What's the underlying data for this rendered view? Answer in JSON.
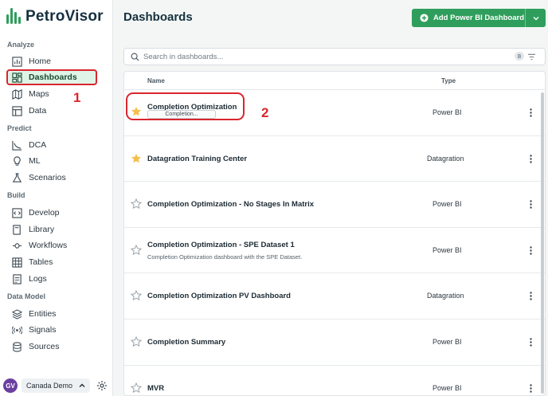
{
  "app": {
    "name": "PetroVisor",
    "brand_color": "#2f9e5c"
  },
  "sidebar": {
    "sections": [
      {
        "title": "Analyze",
        "items": [
          {
            "label": "Home",
            "icon": "chart-icon"
          },
          {
            "label": "Dashboards",
            "icon": "dashboard-icon",
            "active": true
          },
          {
            "label": "Maps",
            "icon": "map-icon"
          },
          {
            "label": "Data",
            "icon": "table-icon"
          }
        ]
      },
      {
        "title": "Predict",
        "items": [
          {
            "label": "DCA",
            "icon": "line-chart-icon"
          },
          {
            "label": "ML",
            "icon": "lightbulb-icon"
          },
          {
            "label": "Scenarios",
            "icon": "flask-icon"
          }
        ]
      },
      {
        "title": "Build",
        "items": [
          {
            "label": "Develop",
            "icon": "code-icon"
          },
          {
            "label": "Library",
            "icon": "book-icon"
          },
          {
            "label": "Workflows",
            "icon": "workflow-icon"
          },
          {
            "label": "Tables",
            "icon": "grid-icon"
          },
          {
            "label": "Logs",
            "icon": "log-icon"
          }
        ]
      },
      {
        "title": "Data Model",
        "items": [
          {
            "label": "Entities",
            "icon": "layers-icon"
          },
          {
            "label": "Signals",
            "icon": "signal-icon"
          },
          {
            "label": "Sources",
            "icon": "database-icon"
          }
        ]
      }
    ],
    "user": {
      "initials": "GV",
      "workspace": "Canada Demo"
    }
  },
  "header": {
    "title": "Dashboards",
    "add_button": "Add Power BI Dashboard"
  },
  "search": {
    "placeholder": "Search in dashboards...",
    "count": "8"
  },
  "table": {
    "columns": {
      "name": "Name",
      "type": "Type"
    },
    "rows": [
      {
        "title": "Completion Optimization",
        "type": "Power BI",
        "starred": true,
        "status": "Completion..."
      },
      {
        "title": "Datagration Training Center",
        "type": "Datagration",
        "starred": true
      },
      {
        "title": "Completion Optimization - No Stages In Matrix",
        "type": "Power BI",
        "starred": false
      },
      {
        "title": "Completion Optimization - SPE Dataset 1",
        "type": "Power BI",
        "starred": false,
        "description": "Completion Optimization dashboard with the SPE Dataset."
      },
      {
        "title": "Completion Optimization PV Dashboard",
        "type": "Datagration",
        "starred": false
      },
      {
        "title": "Completion Summary",
        "type": "Power BI",
        "starred": false
      },
      {
        "title": "MVR",
        "type": "Power BI",
        "starred": false
      }
    ]
  },
  "annotations": {
    "marker_1": "1",
    "marker_2": "2"
  }
}
